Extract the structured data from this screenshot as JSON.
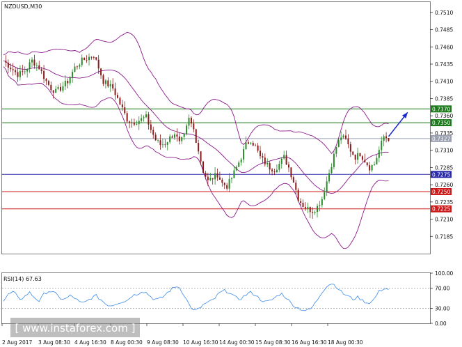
{
  "header": {
    "symbol_label": "NZDUSD,M30",
    "rsi_label": "RSI(14) 67.63"
  },
  "watermark": {
    "text": "[ www.instaforex.com ]"
  },
  "colors": {
    "candle_up": "#2a8a2a",
    "candle_down": "#8b1a1a",
    "bollinger": "#8b1a8b",
    "resistance": "#1a7a1a",
    "support": "#cc1a1a",
    "pivot": "#2a2aaa",
    "current": "#9aa0b0",
    "rsi_line": "#3a8ae8",
    "arrow": "#1a2acc"
  },
  "chart_data": [
    {
      "type": "candlestick",
      "symbol": "NZDUSD",
      "timeframe": "M30",
      "ylim": [
        0.716,
        0.7525
      ],
      "yticks": [
        0.7185,
        0.721,
        0.7235,
        0.726,
        0.7285,
        0.731,
        0.7335,
        0.736,
        0.7385,
        0.741,
        0.7435,
        0.746,
        0.7485,
        0.751
      ],
      "ytick_labels": [
        "0.7185",
        "0.7210",
        "0.7235",
        "0.7260",
        "0.7285",
        "0.7310",
        "0.7335",
        "0.7360",
        "0.7385",
        "0.7410",
        "0.7435",
        "0.7460",
        "0.7485",
        "0.7510"
      ],
      "x_labels": [
        "2 Aug 2017",
        "3 Aug 08:30",
        "4 Aug 16:30",
        "8 Aug 00:30",
        "9 Aug 08:30",
        "10 Aug 16:30",
        "14 Aug 00:30",
        "15 Aug 08:30",
        "16 Aug 16:30",
        "18 Aug 00:30"
      ],
      "levels": [
        {
          "value": 0.737,
          "label": "0.7370",
          "kind": "resistance"
        },
        {
          "value": 0.735,
          "label": "0.7350",
          "kind": "resistance"
        },
        {
          "value": 0.7327,
          "label": "0.7327",
          "kind": "current"
        },
        {
          "value": 0.7275,
          "label": "0.7275",
          "kind": "pivot"
        },
        {
          "value": 0.725,
          "label": "0.7250",
          "kind": "support"
        },
        {
          "value": 0.7225,
          "label": "0.7225",
          "kind": "support"
        }
      ],
      "close_path": [
        [
          0,
          0.744
        ],
        [
          3,
          0.743
        ],
        [
          6,
          0.742
        ],
        [
          9,
          0.7425
        ],
        [
          12,
          0.744
        ],
        [
          15,
          0.743
        ],
        [
          18,
          0.741
        ],
        [
          20,
          0.74
        ],
        [
          22,
          0.7395
        ],
        [
          24,
          0.74
        ],
        [
          27,
          0.741
        ],
        [
          30,
          0.743
        ],
        [
          33,
          0.744
        ],
        [
          36,
          0.7445
        ],
        [
          38,
          0.7448
        ],
        [
          40,
          0.743
        ],
        [
          42,
          0.741
        ],
        [
          44,
          0.7405
        ],
        [
          46,
          0.74
        ],
        [
          48,
          0.7385
        ],
        [
          50,
          0.737
        ],
        [
          52,
          0.7355
        ],
        [
          54,
          0.735
        ],
        [
          56,
          0.7352
        ],
        [
          58,
          0.7355
        ],
        [
          60,
          0.7358
        ],
        [
          62,
          0.734
        ],
        [
          64,
          0.7325
        ],
        [
          66,
          0.7318
        ],
        [
          68,
          0.732
        ],
        [
          70,
          0.7328
        ],
        [
          72,
          0.7335
        ],
        [
          74,
          0.732
        ],
        [
          76,
          0.733
        ],
        [
          78,
          0.7355
        ],
        [
          80,
          0.734
        ],
        [
          82,
          0.731
        ],
        [
          84,
          0.728
        ],
        [
          86,
          0.7265
        ],
        [
          88,
          0.727
        ],
        [
          90,
          0.7275
        ],
        [
          92,
          0.7262
        ],
        [
          94,
          0.7258
        ],
        [
          96,
          0.727
        ],
        [
          98,
          0.7285
        ],
        [
          100,
          0.73
        ],
        [
          102,
          0.7318
        ],
        [
          104,
          0.7325
        ],
        [
          106,
          0.7315
        ],
        [
          108,
          0.73
        ],
        [
          110,
          0.7292
        ],
        [
          112,
          0.7285
        ],
        [
          114,
          0.7282
        ],
        [
          116,
          0.729
        ],
        [
          118,
          0.73
        ],
        [
          120,
          0.7285
        ],
        [
          122,
          0.7265
        ],
        [
          124,
          0.724
        ],
        [
          126,
          0.723
        ],
        [
          128,
          0.7225
        ],
        [
          130,
          0.7222
        ],
        [
          132,
          0.7228
        ],
        [
          134,
          0.724
        ],
        [
          136,
          0.7265
        ],
        [
          138,
          0.729
        ],
        [
          140,
          0.7315
        ],
        [
          142,
          0.733
        ],
        [
          144,
          0.7325
        ],
        [
          146,
          0.731
        ],
        [
          148,
          0.73
        ],
        [
          150,
          0.7305
        ],
        [
          152,
          0.7295
        ],
        [
          154,
          0.7285
        ],
        [
          156,
          0.729
        ],
        [
          158,
          0.731
        ],
        [
          160,
          0.733
        ],
        [
          162,
          0.7327
        ]
      ],
      "arrow": {
        "from": [
          162,
          0.733
        ],
        "to": [
          170,
          0.7365
        ]
      }
    },
    {
      "type": "line",
      "name": "RSI(14)",
      "last_value": 67.63,
      "ylim": [
        0,
        100
      ],
      "yticks": [
        0,
        30,
        70,
        100
      ],
      "ytick_labels": [
        "0.00",
        "30.00",
        "70.00",
        "100.00"
      ],
      "levels": [
        70,
        30
      ],
      "values": [
        45,
        58,
        63,
        48,
        52,
        62,
        52,
        44,
        60,
        65,
        60,
        50,
        48,
        55,
        50,
        40,
        42,
        50,
        55,
        47,
        38,
        35,
        40,
        43,
        45,
        55,
        58,
        65,
        60,
        50,
        47,
        52,
        62,
        70,
        75,
        60,
        40,
        25,
        28,
        38,
        42,
        48,
        60,
        65,
        62,
        52,
        48,
        55,
        62,
        57,
        48,
        42,
        45,
        52,
        60,
        52,
        40,
        32,
        28,
        25,
        30,
        45,
        62,
        75,
        80,
        72,
        60,
        55,
        48,
        52,
        45,
        40,
        45,
        62,
        70,
        67.63
      ]
    }
  ]
}
